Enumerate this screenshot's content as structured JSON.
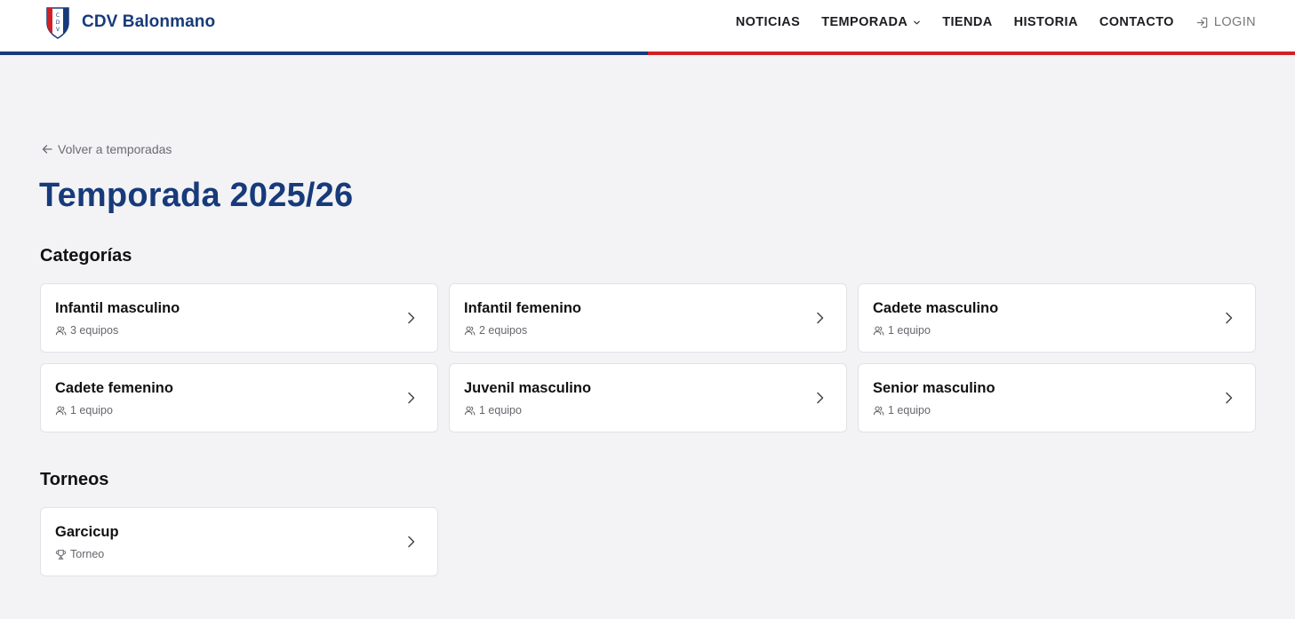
{
  "brand": {
    "name": "CDV Balonmano",
    "logo_letters": "CDV",
    "blue": "#173a7a",
    "red": "#d21f26"
  },
  "nav": {
    "noticias": "NOTICIAS",
    "temporada": "TEMPORADA",
    "tienda": "TIENDA",
    "historia": "HISTORIA",
    "contacto": "CONTACTO",
    "login": "LOGIN"
  },
  "page": {
    "back_link": "Volver a temporadas",
    "title": "Temporada 2025/26"
  },
  "categorias": {
    "title": "Categorías",
    "items": [
      {
        "name": "Infantil masculino",
        "meta": "3 equipos",
        "icon": "users-icon"
      },
      {
        "name": "Infantil femenino",
        "meta": "2 equipos",
        "icon": "users-icon"
      },
      {
        "name": "Cadete masculino",
        "meta": "1 equipo",
        "icon": "users-icon"
      },
      {
        "name": "Cadete femenino",
        "meta": "1 equipo",
        "icon": "users-icon"
      },
      {
        "name": "Juvenil masculino",
        "meta": "1 equipo",
        "icon": "users-icon"
      },
      {
        "name": "Senior masculino",
        "meta": "1 equipo",
        "icon": "users-icon"
      }
    ]
  },
  "torneos": {
    "title": "Torneos",
    "items": [
      {
        "name": "Garcicup",
        "meta": "Torneo",
        "icon": "trophy-icon"
      }
    ]
  }
}
